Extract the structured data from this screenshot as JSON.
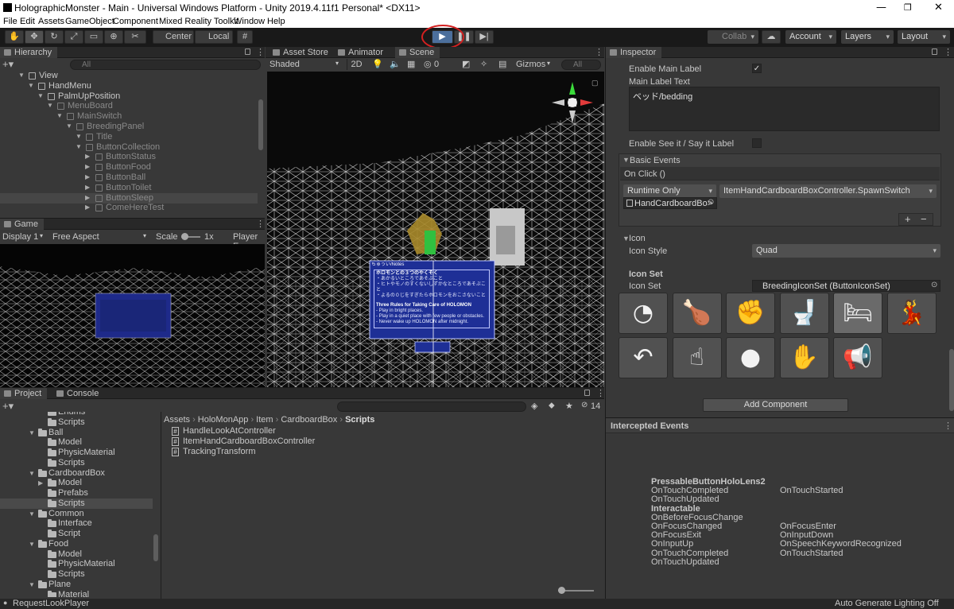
{
  "window": {
    "title": "HolographicMonster - Main - Universal Windows Platform - Unity 2019.4.11f1 Personal* <DX11>"
  },
  "menu": [
    "File",
    "Edit",
    "Assets",
    "GameObject",
    "Component",
    "Mixed Reality Toolkit",
    "Window",
    "Help"
  ],
  "toolbar": {
    "center": "Center",
    "local": "Local",
    "collab": "Collab",
    "account": "Account",
    "layers": "Layers",
    "layout": "Layout"
  },
  "hierarchy": {
    "tab": "Hierarchy",
    "search_placeholder": "All",
    "rows": [
      {
        "label": "View",
        "depth": 3,
        "dim": false
      },
      {
        "label": "HandMenu",
        "depth": 4,
        "dim": false
      },
      {
        "label": "PalmUpPosition",
        "depth": 5,
        "dim": false
      },
      {
        "label": "MenuBoard",
        "depth": 6,
        "dim": true
      },
      {
        "label": "MainSwitch",
        "depth": 7,
        "dim": true
      },
      {
        "label": "BreedingPanel",
        "depth": 8,
        "dim": true
      },
      {
        "label": "Title",
        "depth": 9,
        "dim": true
      },
      {
        "label": "ButtonCollection",
        "depth": 9,
        "dim": true
      },
      {
        "label": "ButtonStatus",
        "depth": 10,
        "dim": true
      },
      {
        "label": "ButtonFood",
        "depth": 10,
        "dim": true
      },
      {
        "label": "ButtonBall",
        "depth": 10,
        "dim": true
      },
      {
        "label": "ButtonToilet",
        "depth": 10,
        "dim": true
      },
      {
        "label": "ButtonSleep",
        "depth": 10,
        "dim": true,
        "selected": true
      },
      {
        "label": "ComeHereTest",
        "depth": 10,
        "dim": true
      }
    ]
  },
  "game": {
    "tab": "Game",
    "display": "Display 1",
    "aspect": "Free Aspect",
    "scale_label": "Scale",
    "scale_value": "1x",
    "player": "Player Eye"
  },
  "scene": {
    "tabs": [
      "Asset Store",
      "Animator",
      "Scene"
    ],
    "shading": "Shaded",
    "mode2d": "2D",
    "hidden_count": "0",
    "gizmos": "Gizmos",
    "search_placeholder": "All",
    "notes_header": "ちゅうい/Notes",
    "notes_jp_title": "ホロモンとの３つのやくそく",
    "notes_jp_1": "・あかるいところであそぶこと",
    "notes_jp_2": "・ヒトやモノのすくないしずかなところであそぶこと",
    "notes_jp_3": "・よるの０じをすぎたらホロモンをおこさないこと",
    "notes_en_title": "Three Rules for Taking Care of HOLOMON",
    "notes_en_1": "- Play in bright places.",
    "notes_en_2": "- Play in a quiet place with few people or obstacles.",
    "notes_en_3": "- Never wake up HOLOMON after midnight."
  },
  "project": {
    "tabs": [
      "Project",
      "Console"
    ],
    "tree": [
      {
        "label": "Enums",
        "depth": 2
      },
      {
        "label": "Scripts",
        "depth": 2
      },
      {
        "label": "Ball",
        "depth": 1,
        "open": true
      },
      {
        "label": "Model",
        "depth": 2
      },
      {
        "label": "PhysicMaterial",
        "depth": 2
      },
      {
        "label": "Scripts",
        "depth": 2
      },
      {
        "label": "CardboardBox",
        "depth": 1,
        "open": true
      },
      {
        "label": "Model",
        "depth": 2,
        "arrow": true
      },
      {
        "label": "Prefabs",
        "depth": 2
      },
      {
        "label": "Scripts",
        "depth": 2,
        "selected": true
      },
      {
        "label": "Common",
        "depth": 1,
        "open": true
      },
      {
        "label": "Interface",
        "depth": 2
      },
      {
        "label": "Script",
        "depth": 2
      },
      {
        "label": "Food",
        "depth": 1,
        "open": true
      },
      {
        "label": "Model",
        "depth": 2
      },
      {
        "label": "PhysicMaterial",
        "depth": 2
      },
      {
        "label": "Scripts",
        "depth": 2
      },
      {
        "label": "Plane",
        "depth": 1,
        "open": true
      },
      {
        "label": "Material",
        "depth": 2
      }
    ],
    "breadcrumb": [
      "Assets",
      "HoloMonApp",
      "Item",
      "CardboardBox",
      "Scripts"
    ],
    "files": [
      "HandleLookAtController",
      "ItemHandCardboardBoxController",
      "TrackingTransform"
    ],
    "count": "14"
  },
  "inspector": {
    "tab": "Inspector",
    "enable_main_label": "Enable Main Label",
    "main_label_text": "Main Label Text",
    "main_label_value": "ベッド/bedding",
    "enable_see_it": "Enable See it / Say it Label",
    "basic_events": "Basic Events",
    "on_click": "On Click ()",
    "runtime": "Runtime Only",
    "function": "ItemHandCardboardBoxController.SpawnSwitch",
    "object": "HandCardboardBo>",
    "icon_section": "Icon",
    "icon_style_label": "Icon Style",
    "icon_style_value": "Quad",
    "icon_set_header": "Icon Set",
    "icon_set_label": "Icon Set",
    "icon_set_value": "BreedingIconSet (ButtonIconSet)",
    "icons": [
      "speedometer-icon",
      "drumstick-icon",
      "fist-icon",
      "toilet-icon",
      "bed-icon",
      "dancer-icon",
      "back-arrow-icon",
      "tap-hand-icon",
      "basketball-icon",
      "open-hand-icon",
      "megaphone-icon"
    ],
    "add_component": "Add Component"
  },
  "intercepted": {
    "title": "Intercepted Events",
    "left": [
      {
        "t": "PressableButtonHoloLens2",
        "b": true
      },
      {
        "t": "OnTouchCompleted",
        "b": false
      },
      {
        "t": "OnTouchUpdated",
        "b": false
      },
      {
        "t": "Interactable",
        "b": true
      },
      {
        "t": "OnBeforeFocusChange",
        "b": false
      },
      {
        "t": "OnFocusChanged",
        "b": false
      },
      {
        "t": "OnFocusExit",
        "b": false
      },
      {
        "t": "OnInputUp",
        "b": false
      },
      {
        "t": "OnTouchCompleted",
        "b": false
      },
      {
        "t": "OnTouchUpdated",
        "b": false
      }
    ],
    "right": [
      "OnTouchStarted",
      "OnFocusEnter",
      "OnInputDown",
      "OnSpeechKeywordRecognized",
      "OnTouchStarted"
    ]
  },
  "status": {
    "left": "RequestLookPlayer",
    "right": "Auto Generate Lighting Off"
  },
  "colors": {
    "highlight_ring": "#d32020",
    "panel_bg": "#383838",
    "scene_bg": "#0a0a0a"
  }
}
